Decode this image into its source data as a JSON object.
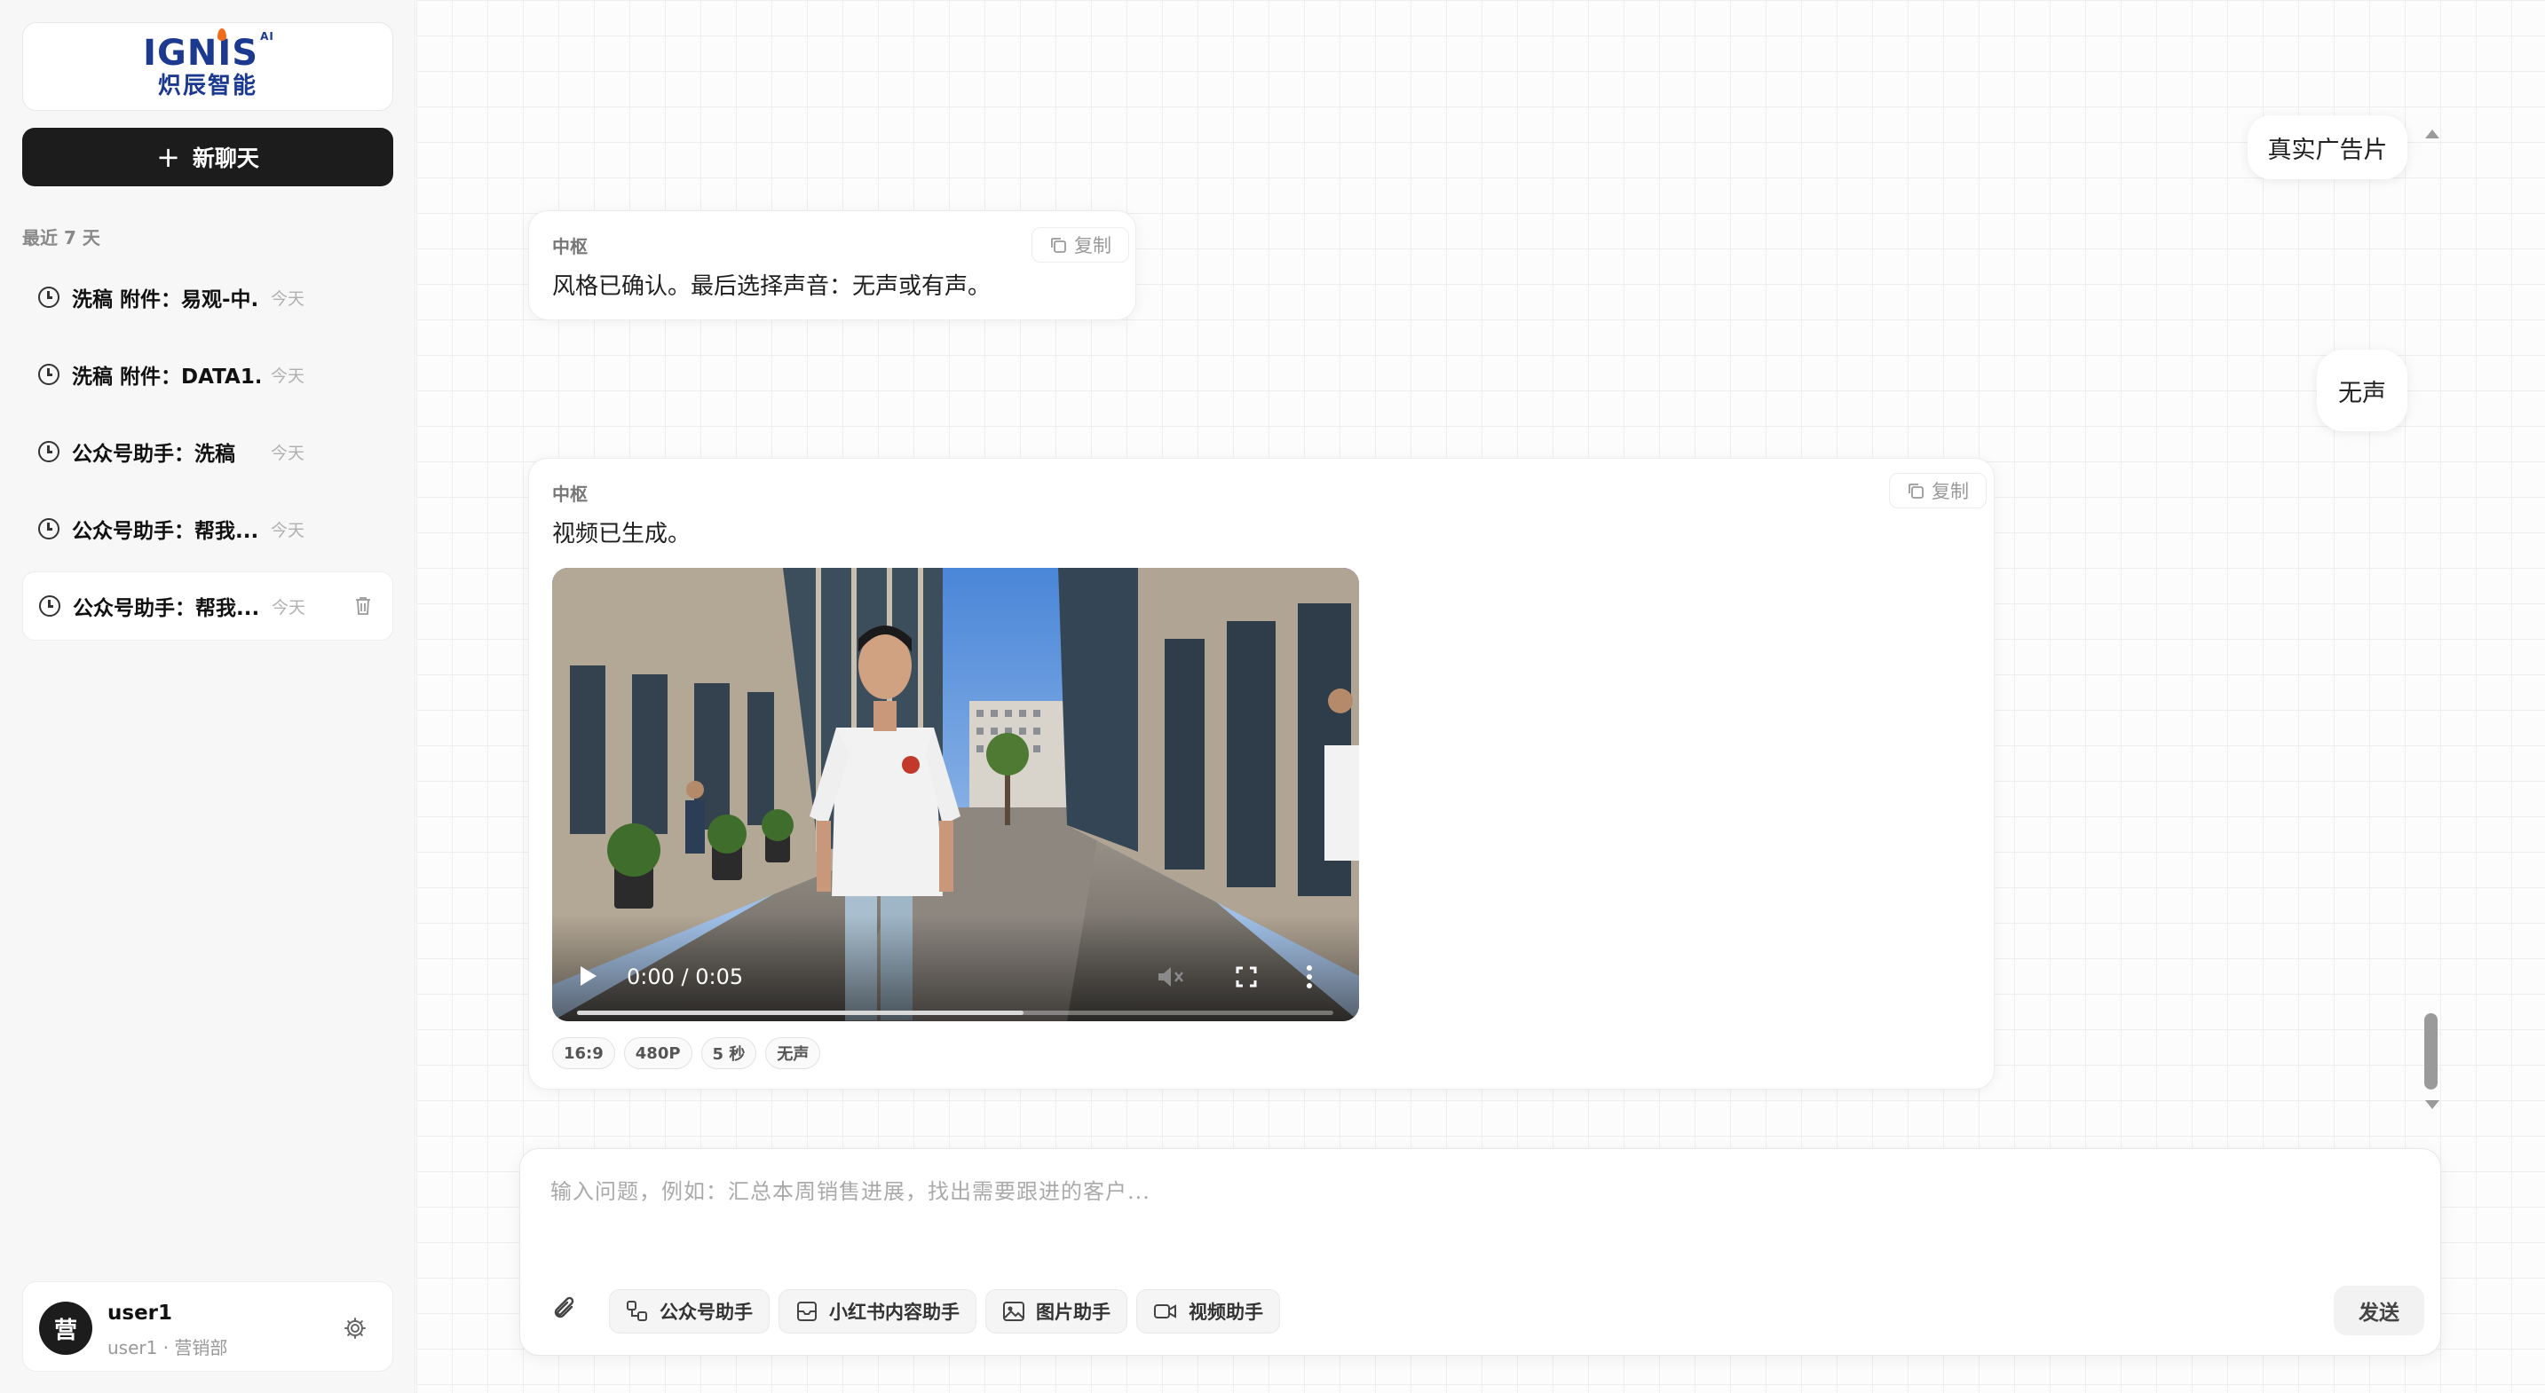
{
  "brand": {
    "name": "IGNIS",
    "superscript": "AI",
    "subtitle": "炽辰智能"
  },
  "sidebar": {
    "new_chat_label": "新聊天",
    "section_label": "最近 7 天",
    "history": [
      {
        "title": "洗稿 附件：易观-中...",
        "time": "今天"
      },
      {
        "title": "洗稿 附件：DATA1...",
        "time": "今天"
      },
      {
        "title": "公众号助手：洗稿",
        "time": "今天"
      },
      {
        "title": "公众号助手：帮我...",
        "time": "今天"
      },
      {
        "title": "公众号助手：帮我...",
        "time": "今天"
      }
    ],
    "user": {
      "avatar_char": "营",
      "name": "user1",
      "dept": "user1 · 营销部"
    }
  },
  "chat": {
    "messages": {
      "user_1": "真实广告片",
      "bot_1": {
        "name": "中枢",
        "text": "风格已确认。最后选择声音：无声或有声。",
        "copy_label": "复制"
      },
      "user_2": "无声",
      "bot_2": {
        "name": "中枢",
        "text": "视频已生成。",
        "copy_label": "复制",
        "video": {
          "time": "0:00 / 0:05",
          "progress": 0.59
        },
        "tags": [
          "16:9",
          "480P",
          "5 秒",
          "无声"
        ]
      }
    }
  },
  "composer": {
    "placeholder": "输入问题，例如：汇总本周销售进展，找出需要跟进的客户...",
    "tools": [
      "公众号助手",
      "小红书内容助手",
      "图片助手",
      "视频助手"
    ],
    "send_label": "发送"
  }
}
